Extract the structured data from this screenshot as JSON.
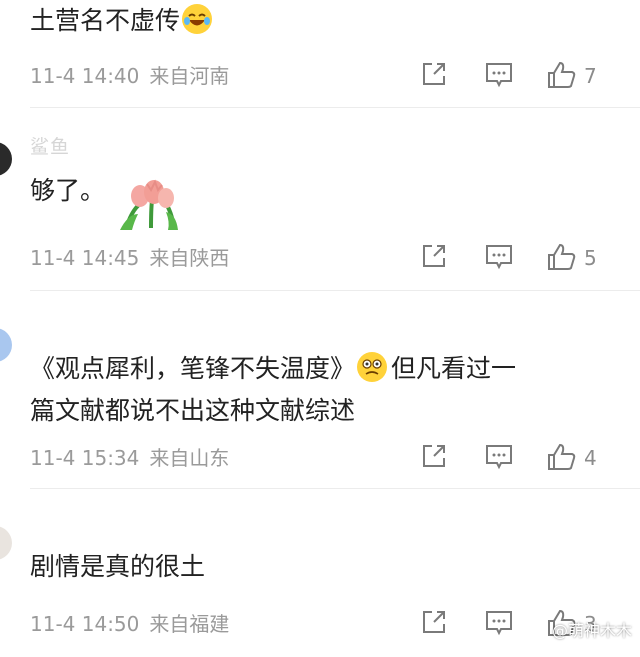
{
  "comments": [
    {
      "username": "",
      "text": "土营名不虚传",
      "date": "11-4 14:40",
      "location": "来自河南",
      "likes": "7",
      "emoji": "laughing-tears"
    },
    {
      "username": "鲨鱼",
      "text": "够了。",
      "date": "11-4 14:45",
      "location": "来自陕西",
      "likes": "5",
      "sticker": "tulips"
    },
    {
      "username": "",
      "text_line1_a": "《观点犀利，笔锋不失温度》",
      "text_line1_b": "但凡看过一",
      "text_line2": "篇文献都说不出这种文献综述",
      "date": "11-4 15:34",
      "location": "来自山东",
      "likes": "4",
      "emoji": "cringe-face"
    },
    {
      "username": "",
      "text": "剧情是真的很土",
      "date": "11-4 14:50",
      "location": "来自福建",
      "likes": "3"
    }
  ],
  "watermark": "@萌神木木",
  "colors": {
    "background": "#ffffff",
    "text": "#222222",
    "meta": "#9a9a9a",
    "divider": "#ececec"
  }
}
